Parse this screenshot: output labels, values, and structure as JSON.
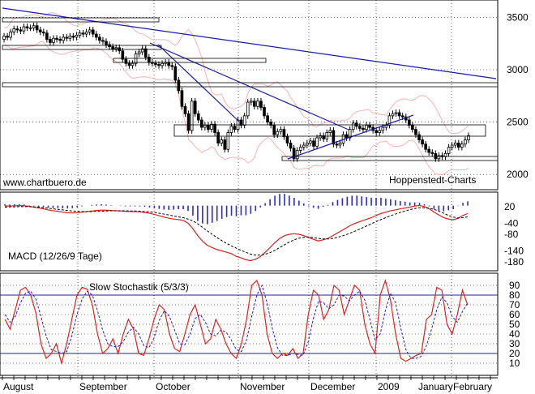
{
  "chart_data": [
    {
      "type": "candlestick",
      "watermark_left": "www.chartbuero.de",
      "watermark_right": "Hoppenstedt-Charts",
      "ylim": [
        1870,
        3650
      ],
      "yticks": [
        2000,
        2500,
        3000,
        3500
      ],
      "candles_open": [
        3290,
        3320,
        3310,
        3360,
        3390,
        3380,
        3370,
        3410,
        3400,
        3400,
        3420,
        3380,
        3360,
        3350,
        3290,
        3260,
        3300,
        3290,
        3280,
        3310,
        3300,
        3320,
        3310,
        3330,
        3350,
        3340,
        3360,
        3380,
        3340,
        3310,
        3280,
        3270,
        3240,
        3220,
        3200,
        3210,
        3180,
        3100,
        3060,
        3040,
        3060,
        3150,
        3170,
        3200,
        3120,
        3070,
        3060,
        3050,
        3040,
        3060,
        3070,
        3040,
        3030,
        2900,
        2800,
        2650,
        2580,
        2420,
        2700,
        2580,
        2520,
        2450,
        2470,
        2430,
        2480,
        2400,
        2300,
        2330,
        2240,
        2400,
        2460,
        2430,
        2520,
        2470,
        2560,
        2690,
        2700,
        2650,
        2700,
        2640,
        2560,
        2500,
        2470,
        2380,
        2410,
        2430,
        2360,
        2300,
        2250,
        2150,
        2230,
        2260,
        2280,
        2300,
        2320,
        2270,
        2350,
        2370,
        2340,
        2400,
        2420,
        2290,
        2280,
        2300,
        2380,
        2350,
        2430,
        2490,
        2460,
        2440,
        2430,
        2470,
        2450,
        2420,
        2400,
        2420,
        2450,
        2470,
        2560,
        2580,
        2590,
        2560,
        2550,
        2520,
        2470,
        2430,
        2380,
        2330,
        2290,
        2240,
        2210,
        2200,
        2150,
        2180,
        2170,
        2200,
        2260,
        2280,
        2300,
        2260,
        2290,
        2330
      ],
      "candles_close": [
        3320,
        3310,
        3360,
        3390,
        3380,
        3370,
        3410,
        3400,
        3400,
        3420,
        3380,
        3360,
        3350,
        3290,
        3260,
        3300,
        3290,
        3280,
        3310,
        3300,
        3320,
        3310,
        3330,
        3350,
        3340,
        3360,
        3380,
        3340,
        3310,
        3280,
        3270,
        3240,
        3220,
        3200,
        3210,
        3180,
        3100,
        3060,
        3040,
        3060,
        3150,
        3170,
        3200,
        3120,
        3070,
        3060,
        3050,
        3040,
        3060,
        3070,
        3040,
        3030,
        2900,
        2800,
        2650,
        2580,
        2420,
        2700,
        2580,
        2520,
        2450,
        2470,
        2430,
        2480,
        2400,
        2300,
        2330,
        2240,
        2400,
        2460,
        2430,
        2520,
        2470,
        2560,
        2690,
        2700,
        2650,
        2700,
        2640,
        2560,
        2500,
        2470,
        2380,
        2410,
        2430,
        2360,
        2300,
        2250,
        2150,
        2230,
        2260,
        2280,
        2300,
        2320,
        2270,
        2350,
        2370,
        2340,
        2400,
        2420,
        2290,
        2280,
        2300,
        2380,
        2350,
        2430,
        2490,
        2460,
        2440,
        2430,
        2470,
        2450,
        2420,
        2400,
        2420,
        2450,
        2470,
        2560,
        2580,
        2590,
        2560,
        2550,
        2520,
        2470,
        2430,
        2380,
        2330,
        2290,
        2240,
        2210,
        2200,
        2150,
        2180,
        2170,
        2200,
        2260,
        2280,
        2300,
        2260,
        2290,
        2330,
        2370
      ]
    },
    {
      "type": "macd",
      "label": "MACD (12/26/9 Tage)",
      "ylim": [
        -200,
        40
      ],
      "yticks_labels": [
        "20",
        "-40",
        "-80",
        "-140",
        "-180"
      ],
      "yticks_values": [
        20,
        -40,
        -80,
        -140,
        -180
      ],
      "macd": [
        22,
        22,
        23,
        24,
        23,
        21,
        18,
        15,
        12,
        8,
        5,
        3,
        0,
        -2,
        -3,
        -2,
        0,
        2,
        4,
        6,
        7,
        7,
        6,
        5,
        4,
        3,
        2,
        2,
        1,
        -1,
        -4,
        -8,
        -13,
        -18,
        -22,
        -25,
        -27,
        -30,
        -40,
        -60,
        -85,
        -105,
        -120,
        -128,
        -135,
        -140,
        -145,
        -150,
        -160,
        -165,
        -172,
        -175,
        -170,
        -160,
        -145,
        -128,
        -110,
        -95,
        -85,
        -80,
        -78,
        -80,
        -85,
        -92,
        -98,
        -104,
        -100,
        -95,
        -85,
        -75,
        -65,
        -55,
        -45,
        -38,
        -32,
        -26,
        -20,
        -12,
        -5,
        0,
        5,
        8,
        12,
        15,
        18,
        22,
        24,
        20,
        12,
        0,
        -10,
        -20,
        -25,
        -28,
        -22,
        -12,
        -5
      ],
      "signal": [
        18,
        19,
        19,
        20,
        20,
        20,
        19,
        18,
        16,
        14,
        12,
        10,
        8,
        6,
        4,
        3,
        2,
        2,
        2,
        3,
        3,
        4,
        5,
        5,
        5,
        5,
        4,
        4,
        3,
        2,
        1,
        -1,
        -4,
        -7,
        -10,
        -14,
        -17,
        -20,
        -25,
        -32,
        -42,
        -55,
        -68,
        -80,
        -92,
        -103,
        -113,
        -122,
        -130,
        -138,
        -145,
        -152,
        -155,
        -155,
        -152,
        -146,
        -138,
        -128,
        -118,
        -108,
        -100,
        -94,
        -91,
        -90,
        -92,
        -95,
        -97,
        -97,
        -95,
        -91,
        -86,
        -80,
        -73,
        -66,
        -58,
        -50,
        -42,
        -34,
        -27,
        -20,
        -13,
        -7,
        -1,
        4,
        9,
        13,
        16,
        16,
        14,
        10,
        4,
        -4,
        -12,
        -18,
        -21,
        -20,
        -17
      ]
    },
    {
      "type": "stochastic",
      "label": "Slow Stochastik (5/3/3)",
      "ylim": [
        0,
        100
      ],
      "yticks": [
        10,
        20,
        30,
        40,
        50,
        60,
        70,
        80,
        90
      ],
      "ref_lines": [
        20,
        80
      ],
      "k": [
        55,
        45,
        65,
        85,
        88,
        80,
        62,
        30,
        15,
        20,
        30,
        10,
        30,
        55,
        80,
        88,
        86,
        70,
        40,
        20,
        25,
        35,
        20,
        40,
        55,
        45,
        20,
        18,
        35,
        55,
        70,
        65,
        40,
        25,
        22,
        40,
        60,
        70,
        50,
        30,
        35,
        55,
        45,
        30,
        20,
        15,
        30,
        55,
        90,
        95,
        80,
        40,
        20,
        15,
        20,
        18,
        25,
        15,
        20,
        60,
        85,
        80,
        55,
        65,
        90,
        85,
        60,
        75,
        90,
        85,
        50,
        30,
        20,
        80,
        95,
        75,
        40,
        15,
        12,
        15,
        18,
        20,
        55,
        60,
        88,
        85,
        50,
        40,
        60,
        85,
        70
      ],
      "d": [
        60,
        52,
        58,
        72,
        82,
        84,
        76,
        58,
        38,
        24,
        22,
        20,
        22,
        38,
        60,
        76,
        84,
        80,
        64,
        44,
        30,
        27,
        27,
        32,
        42,
        47,
        40,
        28,
        26,
        36,
        54,
        64,
        58,
        44,
        30,
        29,
        40,
        56,
        60,
        52,
        40,
        38,
        44,
        42,
        34,
        24,
        22,
        34,
        58,
        80,
        90,
        72,
        46,
        26,
        18,
        18,
        20,
        19,
        18,
        32,
        56,
        74,
        72,
        66,
        70,
        80,
        79,
        74,
        80,
        84,
        75,
        55,
        34,
        40,
        64,
        82,
        72,
        46,
        24,
        15,
        15,
        17,
        28,
        45,
        65,
        78,
        72,
        58,
        52,
        63,
        72
      ]
    }
  ],
  "x_axis": {
    "months": [
      "August",
      "September",
      "October",
      "November",
      "December",
      "2009",
      "January",
      "February"
    ]
  },
  "colors": {
    "candle_up": "#ffffff",
    "candle_down": "#000000",
    "trendline": "#1a1ab0",
    "bollinger": "#f5b4b4",
    "macd_line": "#e02020",
    "histogram": "#2b2bd0",
    "stoch_k": "#e02020",
    "stoch_d": "#2020d0",
    "ref_line": "#2020a0"
  }
}
